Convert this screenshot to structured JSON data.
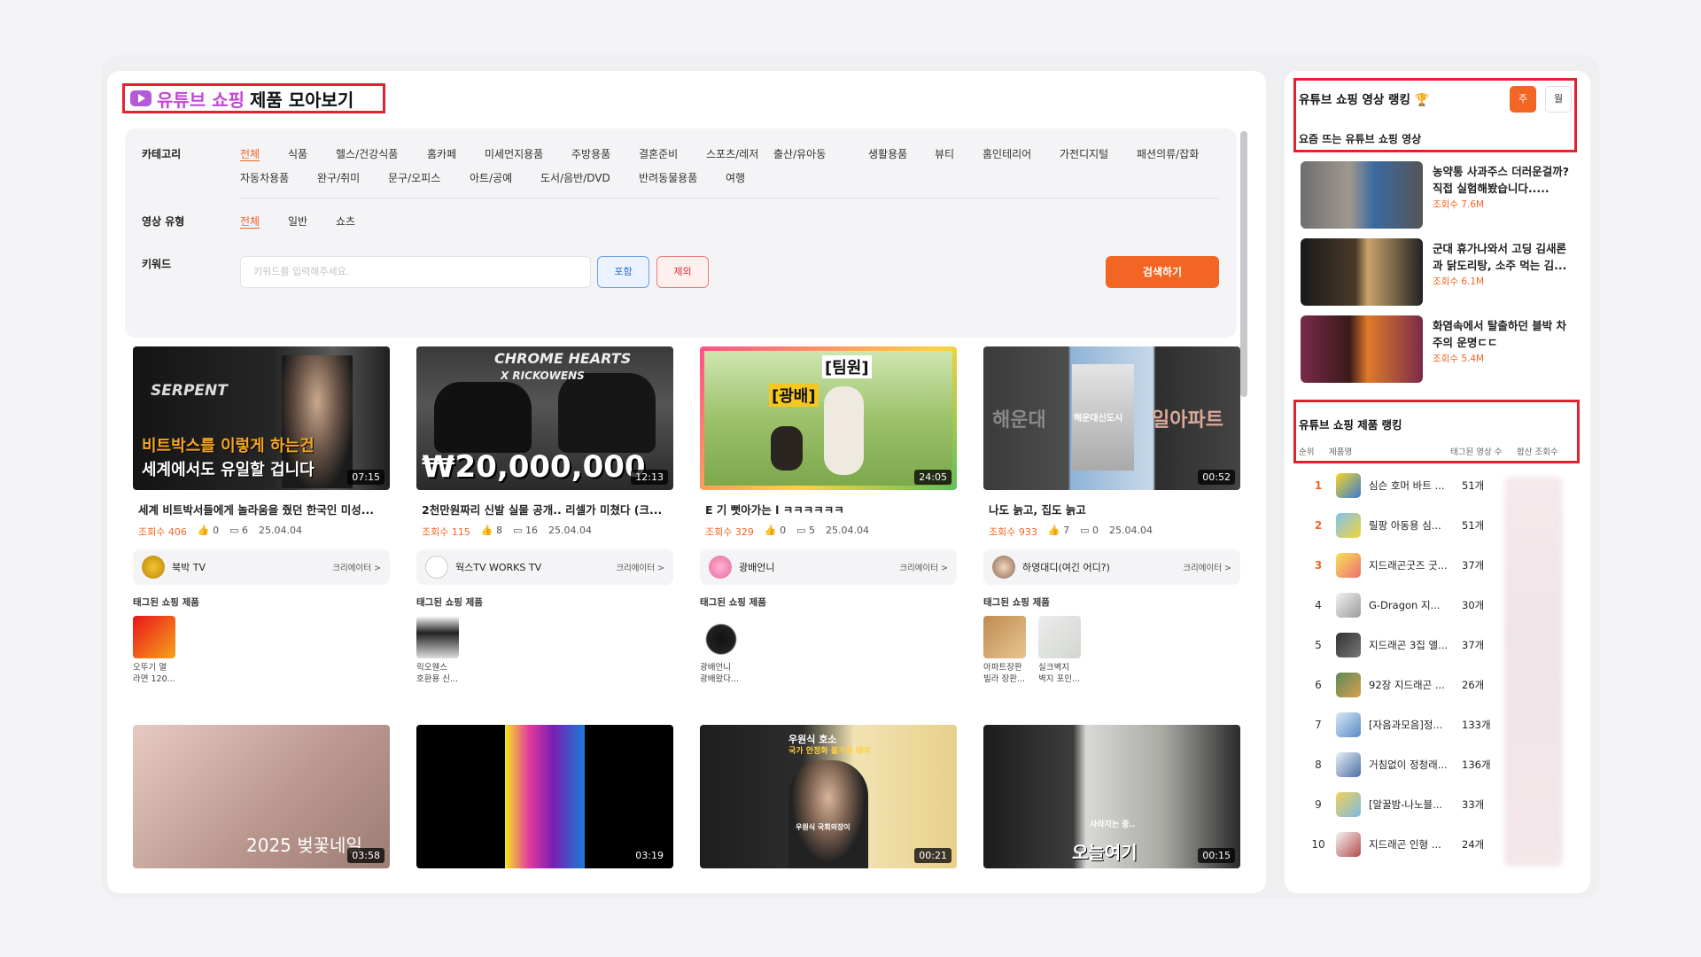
{
  "header": {
    "title_pink": "유튜브 쇼핑",
    "title_black": "제품 모아보기"
  },
  "filters": {
    "category_label": "카테고리",
    "categories": [
      "전체",
      "식품",
      "헬스/건강식품",
      "홈카페",
      "미세먼지용품",
      "주방용품",
      "결혼준비",
      "스포츠/레저",
      "출산/유아동",
      "생활용품",
      "뷰티",
      "홈인테리어",
      "가전디지털",
      "패션의류/잡화",
      "자동차용품",
      "완구/취미",
      "문구/오피스",
      "아트/공예",
      "도서/음반/DVD",
      "반려동물용품",
      "여행"
    ],
    "video_type_label": "영상 유형",
    "video_types": [
      "전체",
      "일반",
      "쇼츠"
    ],
    "keyword_label": "키워드",
    "keyword_placeholder": "키워드를 입력해주세요.",
    "include_label": "포함",
    "exclude_label": "제외",
    "search_label": "검색하기"
  },
  "videos": [
    {
      "thumb_text1": "SERPENT",
      "thumb_text2": "비트박스를 이렇게 하는건",
      "thumb_text3": "세계에서도 유일할 겁니다",
      "duration": "07:15",
      "title": "세계 비트박서들에게 놀라움을 줬던 한국인 미성...",
      "views": "조회수 406",
      "likes": "0",
      "comments": "6",
      "date": "25.04.04",
      "creator": "북박 TV",
      "creator_link": "크리에이터 >",
      "tagged_label": "태그된 쇼핑 제품",
      "products": [
        {
          "name1": "오뚜기 열",
          "name2": "라면 120..."
        }
      ]
    },
    {
      "thumb_text1": "CHROME HEARTS",
      "thumb_text2": "X RICKOWENS",
      "thumb_text3": "₩20,000,000",
      "duration": "12:13",
      "title": "2천만원짜리 신발 실물 공개.. 리셀가 미쳤다 (크...",
      "views": "조회수 115",
      "likes": "8",
      "comments": "16",
      "date": "25.04.04",
      "creator": "웍스TV WORKS TV",
      "creator_link": "크리에이터 >",
      "tagged_label": "태그된 쇼핑 제품",
      "products": [
        {
          "name1": "릭오웬스",
          "name2": "호환용 신..."
        }
      ]
    },
    {
      "thumb_text1": "[팀원]",
      "thumb_text2": "[광배]",
      "thumb_text3": "",
      "duration": "24:05",
      "title": "E 기 뻣아가는 l ㅋㅋㅋㅋㅋㅋ",
      "views": "조회수 329",
      "likes": "0",
      "comments": "5",
      "date": "25.04.04",
      "creator": "광배언니",
      "creator_link": "크리에이터 >",
      "tagged_label": "태그된 쇼핑 제품",
      "products": [
        {
          "name1": "광배언니",
          "name2": "광배왔다..."
        }
      ]
    },
    {
      "thumb_text1": "해운대",
      "thumb_text2": "해운대신도시",
      "thumb_text3": "일아파트",
      "duration": "00:52",
      "title": "나도 늙고, 집도 늙고",
      "views": "조회수 933",
      "likes": "7",
      "comments": "0",
      "date": "25.04.04",
      "creator": "하영대디(여긴 어디?)",
      "creator_link": "크리에이터 >",
      "tagged_label": "태그된 쇼핑 제품",
      "products": [
        {
          "name1": "아파트장판",
          "name2": "빌라 장판..."
        },
        {
          "name1": "실크벽지",
          "name2": "벽지 포인..."
        }
      ]
    },
    {
      "thumb_text1": "2025 벚꽃네일",
      "duration": "03:58"
    },
    {
      "thumb_text1": "",
      "duration": "03:19"
    },
    {
      "thumb_text1": "우원식 호소",
      "thumb_text2": "국가 안정화 불가결 돼야",
      "thumb_text3": "우원식 국회의장이",
      "duration": "00:21"
    },
    {
      "thumb_text1": "오늘여기",
      "thumb_text2": "사라지는 중..",
      "duration": "00:15"
    }
  ],
  "sidebar": {
    "video_rank_title": "유튜브 쇼핑 영상 랭킹 🏆",
    "tab_week": "주",
    "tab_month": "월",
    "trending_label": "요즘 뜨는 유튜브 쇼핑 영상",
    "trending": [
      {
        "title": "농약통 사과주스 더러운걸까? 직접 실험해봤습니다.....",
        "views": "조회수 7.6M"
      },
      {
        "title": "군대 휴가나와서 고딩 김새론과 닭도리탕, 소주 먹는 김...",
        "views": "조회수 6.1M"
      },
      {
        "title": "화염속에서 탈출하던 블박 차주의 운명ㄷㄷ",
        "views": "조회수 5.4M"
      }
    ],
    "product_rank_title": "유튜브 쇼핑 제품 랭킹",
    "product_rank_headers": [
      "순위",
      "제품명",
      "태그된 영상 수",
      "합산 조회수"
    ],
    "products": [
      {
        "rank": "1",
        "name": "심슨 호머 바트 ...",
        "count": "51개"
      },
      {
        "rank": "2",
        "name": "릴팡 아동용 심...",
        "count": "51개"
      },
      {
        "rank": "3",
        "name": "지드래곤굿즈 굿...",
        "count": "37개"
      },
      {
        "rank": "4",
        "name": "G-Dragon 지...",
        "count": "30개"
      },
      {
        "rank": "5",
        "name": "지드래곤 3집 앨...",
        "count": "37개"
      },
      {
        "rank": "6",
        "name": "92장 지드래곤 ...",
        "count": "26개"
      },
      {
        "rank": "7",
        "name": "[자음과모음]정...",
        "count": "133개"
      },
      {
        "rank": "8",
        "name": "거침없이 정청래...",
        "count": "136개"
      },
      {
        "rank": "9",
        "name": "[알꿀밤-나노블...",
        "count": "33개"
      },
      {
        "rank": "10",
        "name": "지드래곤 인형 ...",
        "count": "24개"
      }
    ]
  },
  "colors": {
    "accent": "#f26522",
    "highlight_box": "#e1232f",
    "brand_pink": "#c447d6"
  }
}
